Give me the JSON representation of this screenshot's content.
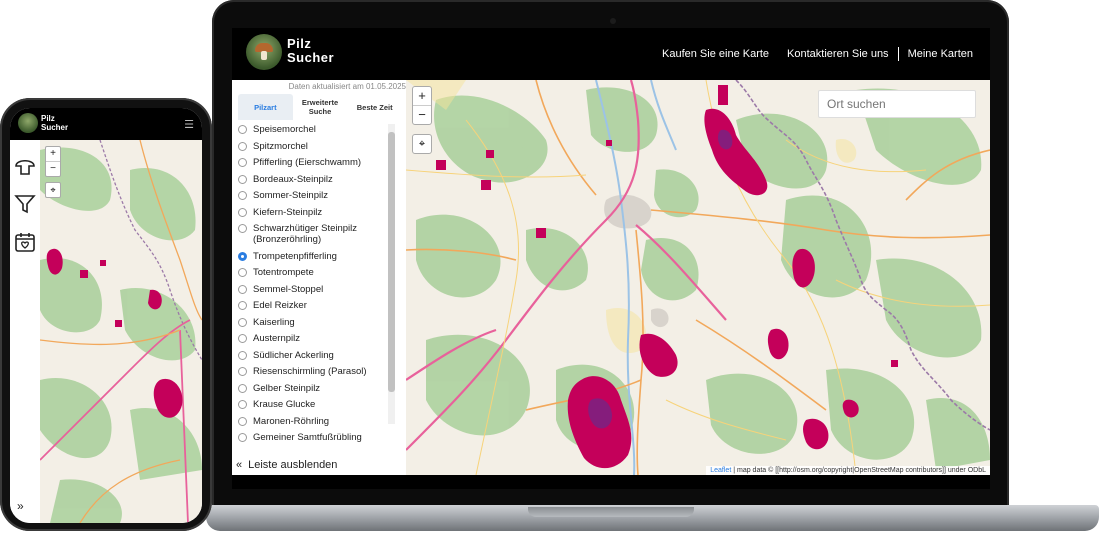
{
  "header": {
    "logo_line1": "Pilz",
    "logo_line2": "Sucher",
    "nav": [
      "Kaufen Sie eine Karte",
      "Kontaktieren Sie uns",
      "Meine Karten"
    ]
  },
  "sidebar": {
    "updated": "Daten aktualisiert am 01.05.2025",
    "tabs": [
      {
        "label": "Pilzart",
        "active": true
      },
      {
        "label": "Erweiterte Suche",
        "active": false
      },
      {
        "label": "Beste Zeit",
        "active": false
      }
    ],
    "items": [
      {
        "label": "Speisemorchel",
        "selected": false
      },
      {
        "label": "Spitzmorchel",
        "selected": false
      },
      {
        "label": "Pfifferling (Eierschwamm)",
        "selected": false
      },
      {
        "label": "Bordeaux-Steinpilz",
        "selected": false
      },
      {
        "label": "Sommer-Steinpilz",
        "selected": false
      },
      {
        "label": "Kiefern-Steinpilz",
        "selected": false
      },
      {
        "label": "Schwarzhütiger Steinpilz (Bronzeröhrling)",
        "selected": false
      },
      {
        "label": "Trompetenpfifferling",
        "selected": true
      },
      {
        "label": "Totentrompete",
        "selected": false
      },
      {
        "label": "Semmel-Stoppel",
        "selected": false
      },
      {
        "label": "Edel Reizker",
        "selected": false
      },
      {
        "label": "Kaiserling",
        "selected": false
      },
      {
        "label": "Austernpilz",
        "selected": false
      },
      {
        "label": "Südlicher Ackerling",
        "selected": false
      },
      {
        "label": "Riesenschirmling (Parasol)",
        "selected": false
      },
      {
        "label": "Gelber Steinpilz",
        "selected": false
      },
      {
        "label": "Krause Glucke",
        "selected": false
      },
      {
        "label": "Maronen-Röhrling",
        "selected": false
      },
      {
        "label": "Gemeiner Samtfußrübling",
        "selected": false
      }
    ],
    "collapse_label": "Leiste ausblenden"
  },
  "map": {
    "zoom_in": "+",
    "zoom_out": "−",
    "search_placeholder": "Ort suchen",
    "attribution_leaflet": "Leaflet",
    "attribution_rest": "| map data © [[http://osm.org/copyright|OpenStreetMap contributors]] under ODbL"
  },
  "phone": {
    "logo_line1": "Pilz",
    "logo_line2": "Sucher"
  },
  "colors": {
    "accent": "#2a7de1",
    "header_bg": "#000000",
    "hotspot": "#c4005a",
    "forest": "#add19e",
    "road_pink": "#e8619b",
    "road_orange": "#f2a85b",
    "border": "#9c7aa8"
  }
}
